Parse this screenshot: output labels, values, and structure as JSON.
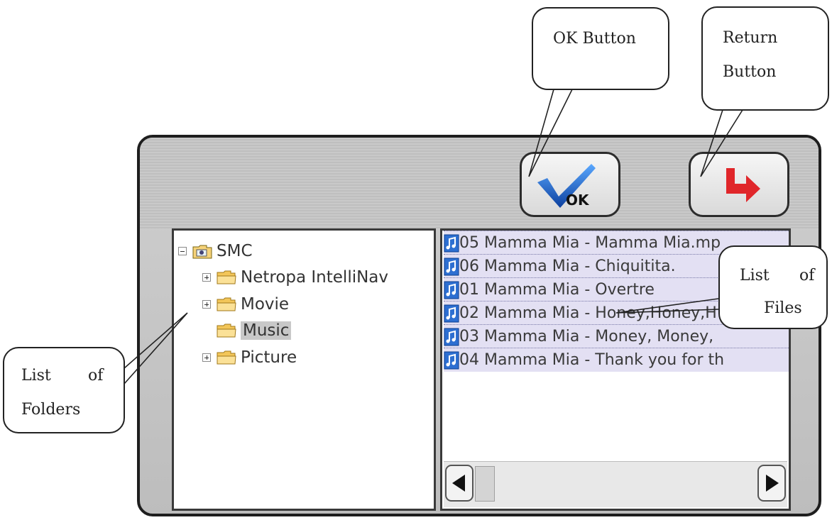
{
  "buttons": {
    "ok_text": "OK"
  },
  "folder_tree": {
    "root": "SMC",
    "items": [
      {
        "label": "Netropa IntelliNav",
        "expandable": true
      },
      {
        "label": "Movie",
        "expandable": true
      },
      {
        "label": "Music",
        "expandable": false,
        "selected": true
      },
      {
        "label": "Picture",
        "expandable": true
      }
    ]
  },
  "file_list": {
    "items": [
      "05 Mamma Mia - Mamma Mia.mp",
      "06 Mamma Mia - Chiquitita.",
      "01 Mamma Mia - Overtre",
      "02 Mamma Mia - Honey,Honey,H",
      "03 Mamma Mia - Money, Money,",
      "04 Mamma Mia - Thank you for th"
    ]
  },
  "callouts": {
    "ok_button": "OK Button",
    "return_button": [
      "Return",
      "Button"
    ],
    "list_of_files": [
      "List",
      "of",
      "Files"
    ],
    "list_of_folders": [
      "List",
      "of",
      "Folders"
    ]
  },
  "colors": {
    "file_row_bg": "#e3e0f3",
    "selected_folder_bg": "#c8c8c8",
    "return_arrow": "#e0262a",
    "ok_check": "#1a63c7"
  },
  "icons": {
    "ok_button": "checkmark-ok-icon",
    "return_button": "return-arrow-icon",
    "folder": "folder-icon",
    "file": "music-file-icon",
    "scroll_left": "triangle-left-icon",
    "scroll_right": "triangle-right-icon"
  }
}
